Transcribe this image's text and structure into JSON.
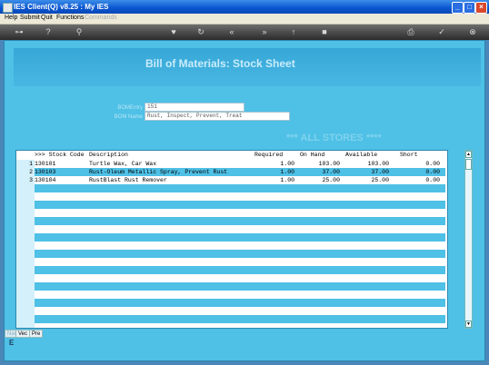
{
  "window": {
    "title": "IES Client(Q) v8.25 : My IES"
  },
  "menu": [
    {
      "label": "Help",
      "enabled": true
    },
    {
      "label": "Submit",
      "enabled": true
    },
    {
      "label": "Quit",
      "enabled": true
    },
    {
      "label": "Functions",
      "enabled": true
    },
    {
      "label": "Commands",
      "enabled": false
    }
  ],
  "page": {
    "title": "Bill of Materials: Stock Sheet",
    "bom_entry": {
      "label": "BOMEntry",
      "value": "151"
    },
    "bom_name": {
      "label": "BOM Name",
      "value": "Rust, Inspect, Prevent, Treat"
    },
    "stores_banner": "*** ALL STORES ****"
  },
  "grid": {
    "columns": [
      ">>> Stock Code",
      "Description",
      "Required",
      "On Hand",
      "Available",
      "Short"
    ],
    "rows": [
      {
        "n": "1",
        "code": "130101",
        "desc": "Turtle Wax, Car Wax",
        "required": "1.00",
        "on_hand": "103.00",
        "available": "103.00",
        "short": "0.00"
      },
      {
        "n": "2",
        "code": "130103",
        "desc": "Rust-Oleum Metallic Spray, Prevent Rust",
        "required": "1.00",
        "on_hand": "37.00",
        "available": "37.00",
        "short": "0.00"
      },
      {
        "n": "3",
        "code": "130104",
        "desc": "RustBlast Rust Remover",
        "required": "1.00",
        "on_hand": "25.00",
        "available": "25.00",
        "short": "0.00"
      }
    ]
  },
  "tabs": [
    "Nav",
    "Vec",
    "Pre"
  ],
  "footer_mark": "E",
  "colors": {
    "accent": "#4fc0e6",
    "row_band": "#4fc0e6",
    "selected_row": "#4fc0e6"
  }
}
